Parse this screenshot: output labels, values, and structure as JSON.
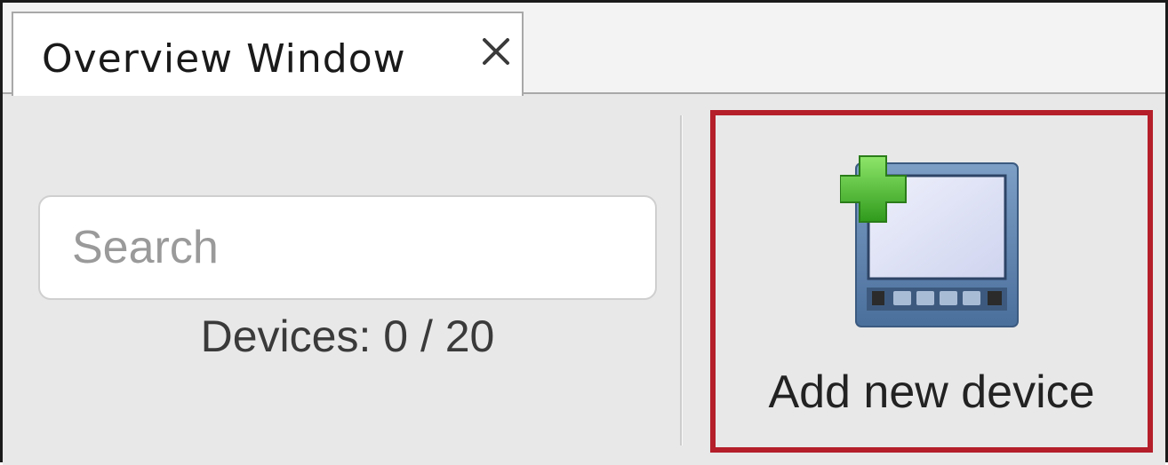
{
  "tab": {
    "title": "Overview Window",
    "close_icon": "close-icon"
  },
  "search": {
    "placeholder": "Search",
    "value": ""
  },
  "devices": {
    "count_label": "Devices: 0 / 20"
  },
  "add_device": {
    "label": "Add new device",
    "icon": "add-device-icon",
    "highlight_color": "#b41f2a"
  }
}
